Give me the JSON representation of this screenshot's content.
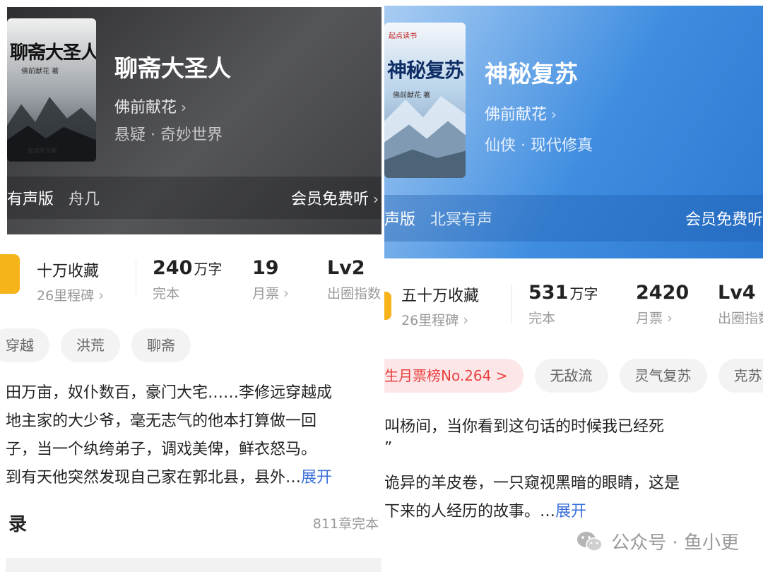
{
  "left": {
    "cover": {
      "title": "聊斋大圣人",
      "subtitle": "佛前献花 著",
      "brand": "起点中文网"
    },
    "title": "聊斋大圣人",
    "author": "佛前献花",
    "genre": "悬疑 · 奇妙世界",
    "audio": {
      "label": "有声版",
      "narrator": "舟几",
      "action": "会员免费听"
    },
    "stats": {
      "collect_main": "十万收藏",
      "collect_sub": "26里程碑",
      "words_num": "240",
      "words_unit": "万字",
      "words_label": "完本",
      "tickets_num": "19",
      "tickets_label": "月票",
      "level_num": "Lv2",
      "level_label": "出圈指数"
    },
    "tags": [
      "穿越",
      "洪荒",
      "聊斋"
    ],
    "synopsis": [
      "田万亩，奴仆数百，豪门大宅……李修远穿越成",
      "地主家的大少爷，毫无志气的他本打算做一回",
      "子，当一个纨绔弟子，调戏美俾，鲜衣怒马。",
      "到有天他突然发现自己家在郭北县，县外…"
    ],
    "expand": "展开",
    "catalog": {
      "title": "录",
      "count": "811章完本"
    }
  },
  "right": {
    "cover": {
      "title": "神秘复苏",
      "subtitle": "佛前献花 著",
      "brand": "起点读书"
    },
    "title": "神秘复苏",
    "author": "佛前献花",
    "genre": "仙侠 · 现代修真",
    "audio": {
      "label": "声版",
      "narrator": "北冥有声",
      "action": "会员免费听"
    },
    "stats": {
      "collect_main": "五十万收藏",
      "collect_sub": "26里程碑",
      "words_num": "531",
      "words_unit": "万字",
      "words_label": "完本",
      "tickets_num": "2420",
      "tickets_label": "月票",
      "level_num": "Lv4",
      "level_label": "出圈指数"
    },
    "tags": [
      "生月票榜No.264 >",
      "无敌流",
      "灵气复苏",
      "克苏"
    ],
    "synopsis": [
      "叫杨间，当你看到这句话的时候我已经死",
      "”",
      "诡异的羊皮卷，一只窥视黑暗的眼睛，这是",
      "下来的人经历的故事。…"
    ],
    "expand": "展开"
  },
  "watermark": {
    "text": "公众号 · 鱼小更",
    "icon": "wechat-icon"
  },
  "colors": {
    "badge": "#f6b31a",
    "expand_link": "#3a6fd8",
    "hot_tag": "#e8413f",
    "left_header": "#3d3e42",
    "right_header": "#3f8de0"
  }
}
